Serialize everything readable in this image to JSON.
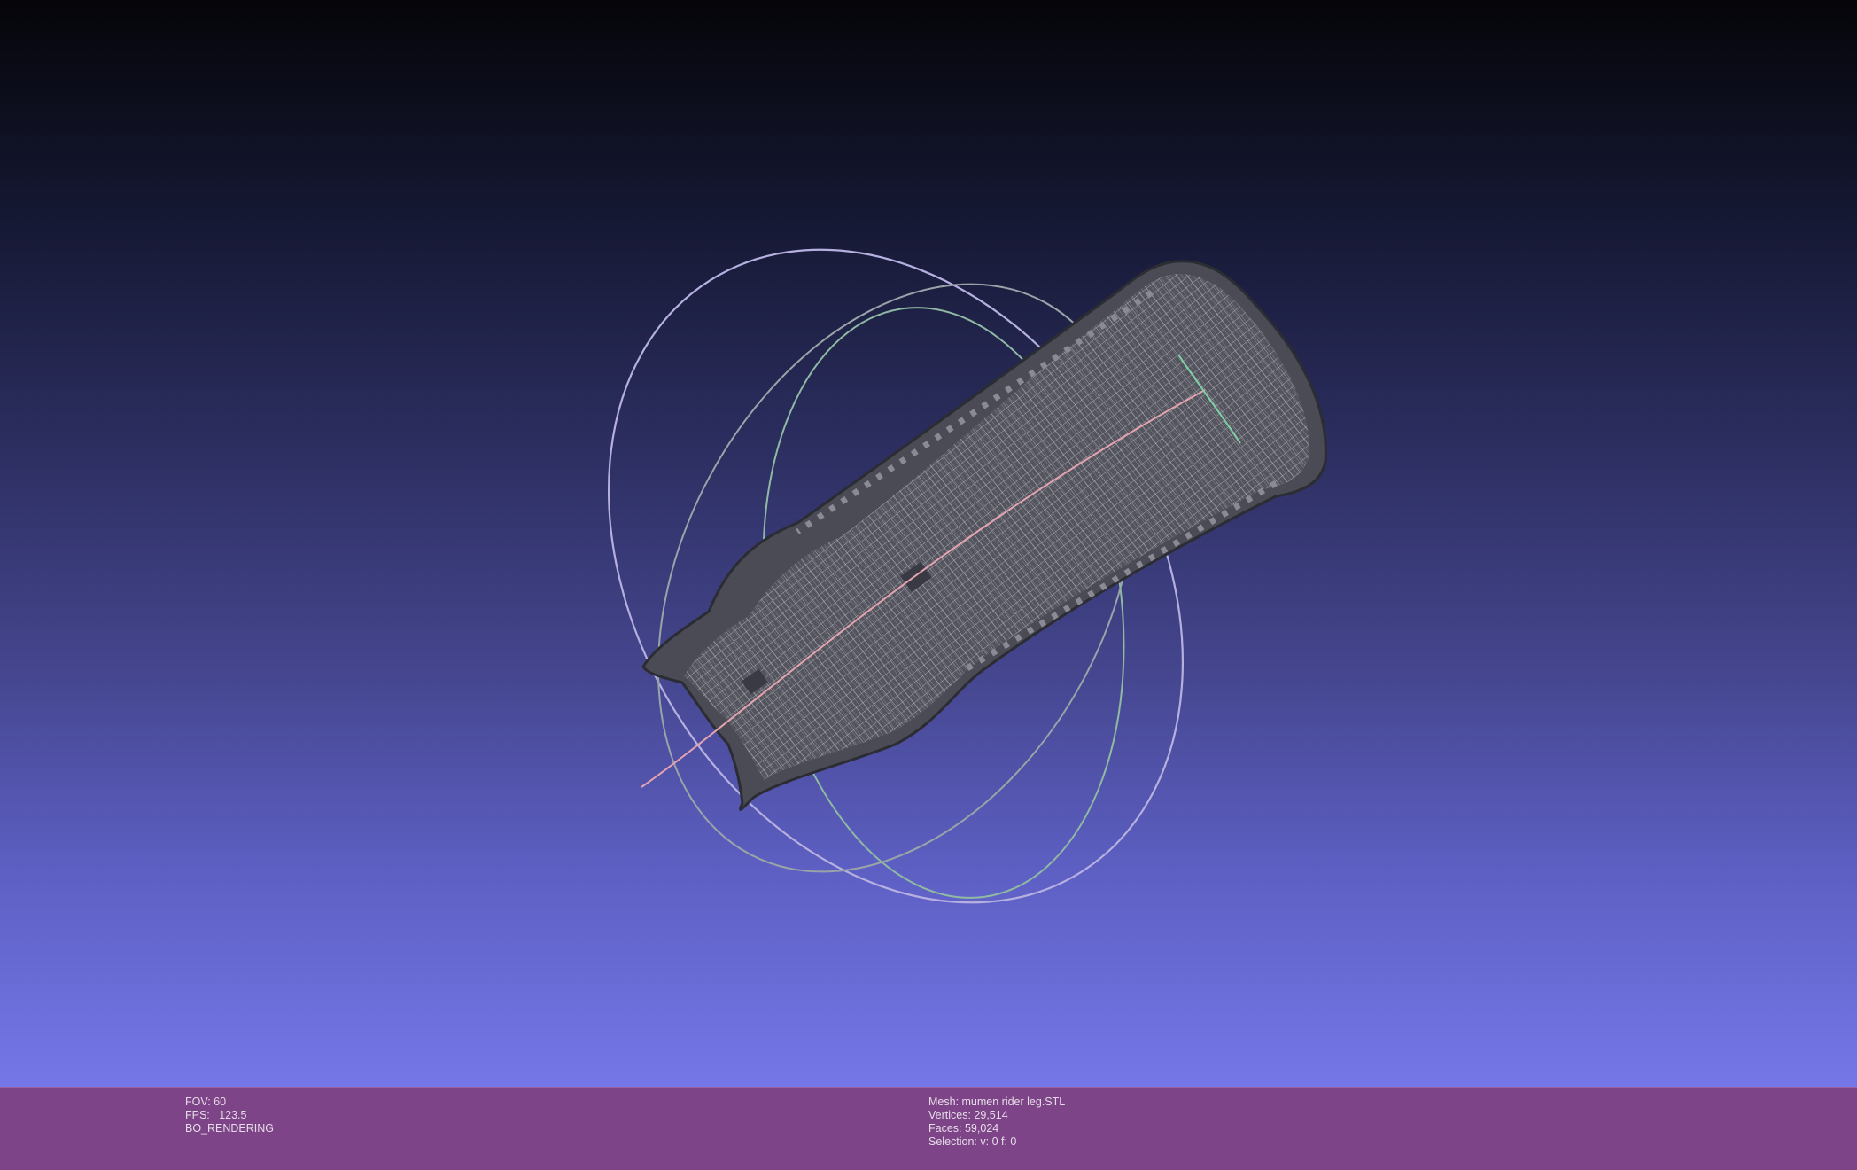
{
  "viewer": {
    "background_top": "#050509",
    "background_bottom": "#7577e8",
    "info_bar_color": "#7d4587"
  },
  "info_left": {
    "fov": "FOV: 60",
    "fps": "FPS:   123.5",
    "mode": "BO_RENDERING"
  },
  "info_right": {
    "mesh": "Mesh: mumen rider leg.STL",
    "vertices": "Vertices: 29,514",
    "faces": "Faces: 59,024",
    "selection": "Selection: v: 0 f: 0"
  }
}
